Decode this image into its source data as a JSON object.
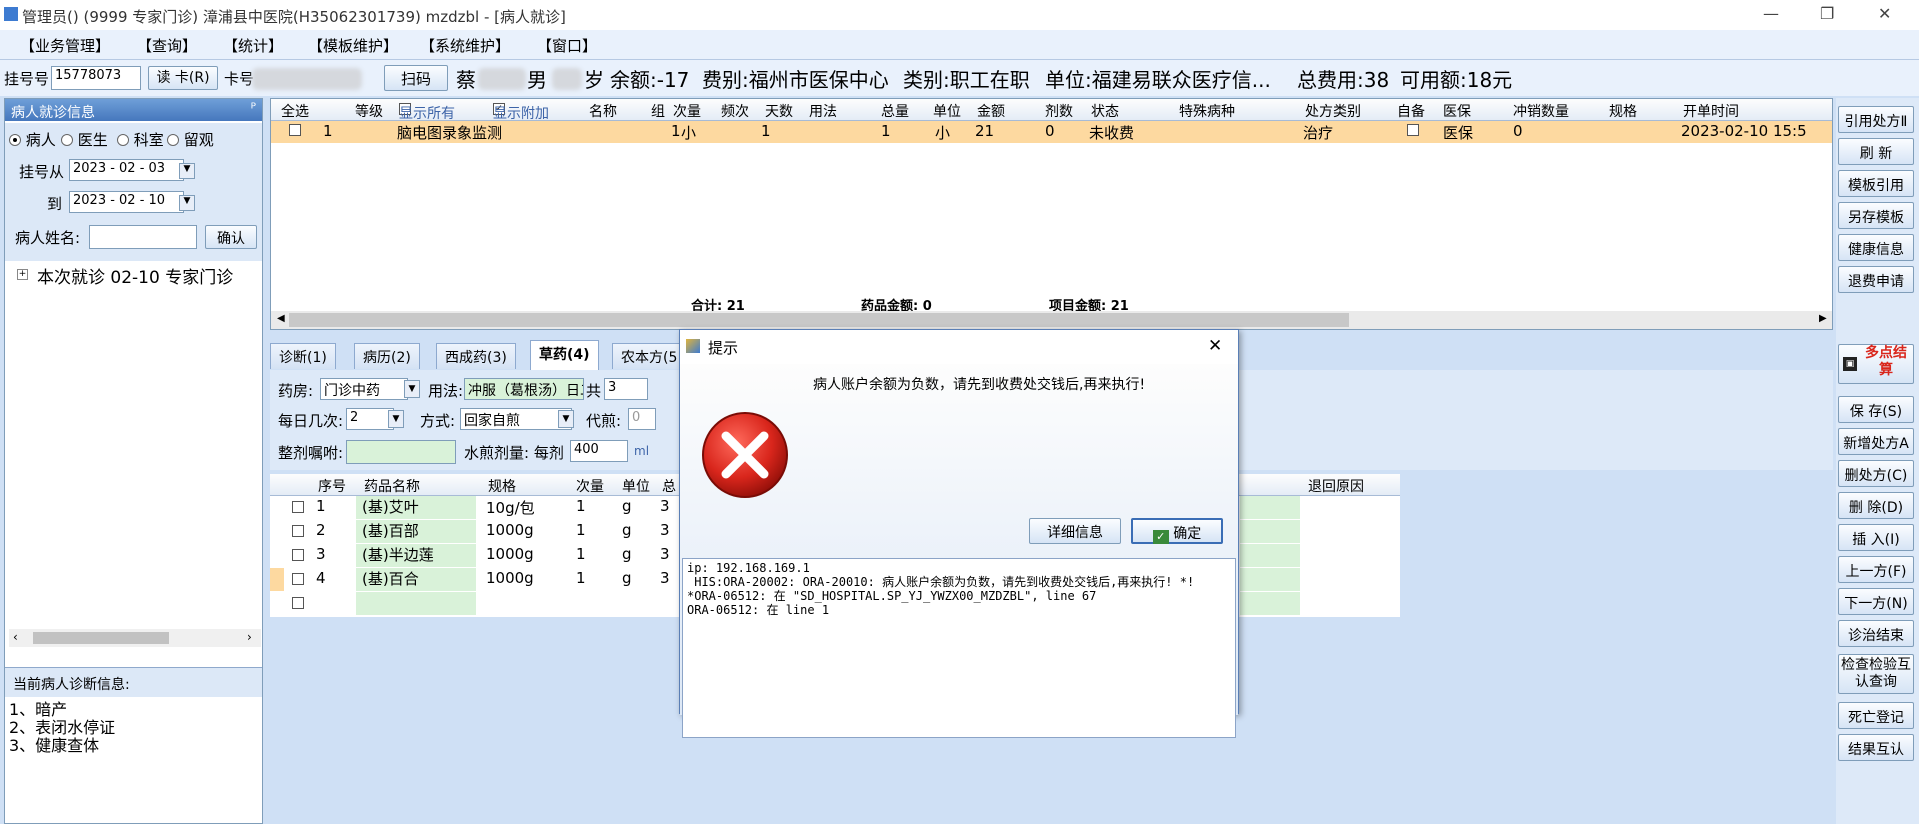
{
  "window": {
    "title": "管理员() (9999 专家门诊) 漳浦县中医院(H35062301739) mzdzbl - [病人就诊]",
    "min": "—",
    "restore": "❐",
    "close": "✕"
  },
  "menu": [
    "【业务管理】",
    "【查询】",
    "【统计】",
    "【模板维护】",
    "【系统维护】",
    "【窗口】"
  ],
  "infobar": {
    "reg_label": "挂号号",
    "reg_value": "15778073",
    "read_card": "读 卡(R)",
    "card_label": "卡号",
    "scan": "扫码",
    "patient_prefix": "蔡",
    "gender": "男",
    "age_suffix": "岁",
    "balance": "余额:-17",
    "fee_type": "费别:福州市医保中心",
    "category": "类别:职工在职",
    "unit": "单位:福建易联众医疗信...",
    "total_fee": "总费用:38",
    "available": "可用额:18元"
  },
  "left": {
    "header": "病人就诊信息",
    "pin": "ᴾ",
    "radios": [
      "病人",
      "医生",
      "科室",
      "留观"
    ],
    "reg_from_label": "挂号从",
    "date_from": "2023 - 02 - 03",
    "to_label": "到",
    "date_to": "2023 - 02 - 10",
    "name_label": "病人姓名:",
    "confirm": "确认",
    "tree_item": "本次就诊 02-10 专家门诊",
    "diag_header": "当前病人诊断信息:",
    "diagnoses": [
      "1、暗产",
      "2、表闭水停证",
      "3、健康查体"
    ]
  },
  "grid": {
    "headers": [
      "全选",
      "等级",
      "显示所有",
      "显示附加",
      "名称",
      "组",
      "次量",
      "频次",
      "天数",
      "用法",
      "总量",
      "单位",
      "金额",
      "剂数",
      "状态",
      "特殊病种",
      "处方类别",
      "自备",
      "医保",
      "冲销数量",
      "规格",
      "开单时间"
    ],
    "row": {
      "no": "1",
      "name": "脑电图录象监测",
      "group": "1",
      "dose": "小",
      "days": "1",
      "total": "1",
      "unit": "小",
      "amount": "21",
      "doses": "0",
      "status": "未收费",
      "rx_type": "治疗",
      "insurance": "医保",
      "offset": "0",
      "time": "2023-02-10 15:5"
    },
    "sum_total": "合计: 21",
    "sum_drug": "药品金额: 0",
    "sum_item": "项目金额: 21"
  },
  "tabs": [
    "诊断(1)",
    "病历(2)",
    "西成药(3)",
    "草药(4)",
    "农本方(5"
  ],
  "form": {
    "pharmacy_label": "药房:",
    "pharmacy": "门诊中药",
    "usage_label": "用法:",
    "usage": "冲服（葛根汤）日二次",
    "total_label": "共",
    "total": "3",
    "times_label": "每日几次:",
    "times": "2",
    "method_label": "方式:",
    "method": "回家自煎",
    "proxy_label": "代煎:",
    "proxy": "0",
    "advice_label": "整剂嘱咐:",
    "water_label": "水煎剂量: 每剂",
    "water": "400",
    "water_unit": "ml"
  },
  "sgrid": {
    "headers": [
      "序号",
      "药品名称",
      "规格",
      "次量",
      "单位",
      "总",
      "退回原因"
    ],
    "rows": [
      {
        "no": "1",
        "name": "(基)艾叶",
        "spec": "10g/包",
        "qty": "1",
        "unit": "g",
        "tot": "3"
      },
      {
        "no": "2",
        "name": "(基)百部",
        "spec": "1000g",
        "qty": "1",
        "unit": "g",
        "tot": "3"
      },
      {
        "no": "3",
        "name": "(基)半边莲",
        "spec": "1000g",
        "qty": "1",
        "unit": "g",
        "tot": "3"
      },
      {
        "no": "4",
        "name": "(基)百合",
        "spec": "1000g",
        "qty": "1",
        "unit": "g",
        "tot": "3"
      }
    ]
  },
  "right": [
    "引用处方Ⅱ",
    "刷 新",
    "模板引用",
    "另存模板",
    "健康信息",
    "退费申请",
    "多点结算",
    "保 存(S)",
    "新增处方A",
    "删处方(C)",
    "删 除(D)",
    "插 入(I)",
    "上一方(F)",
    "下一方(N)",
    "诊治结束",
    "检查检验互认查询",
    "死亡登记",
    "结果互认"
  ],
  "dialog": {
    "title": "提示",
    "close": "✕",
    "message": "病人账户余额为负数，请先到收费处交钱后,再来执行!",
    "detail_btn": "详细信息",
    "ok_btn": "确定",
    "detail": "ip: 192.168.169.1\n HIS:ORA-20002: ORA-20010: 病人账户余额为负数，请先到收费处交钱后,再来执行! *! *ORA-06512: 在 \"SD_HOSPITAL.SP_YJ_YWZX00_MZDZBL\", line 67\nORA-06512: 在 line 1"
  },
  "colors": {
    "accent": "#4577bd",
    "row_highlight": "#fdd9a0",
    "error_red": "#d9261c"
  }
}
